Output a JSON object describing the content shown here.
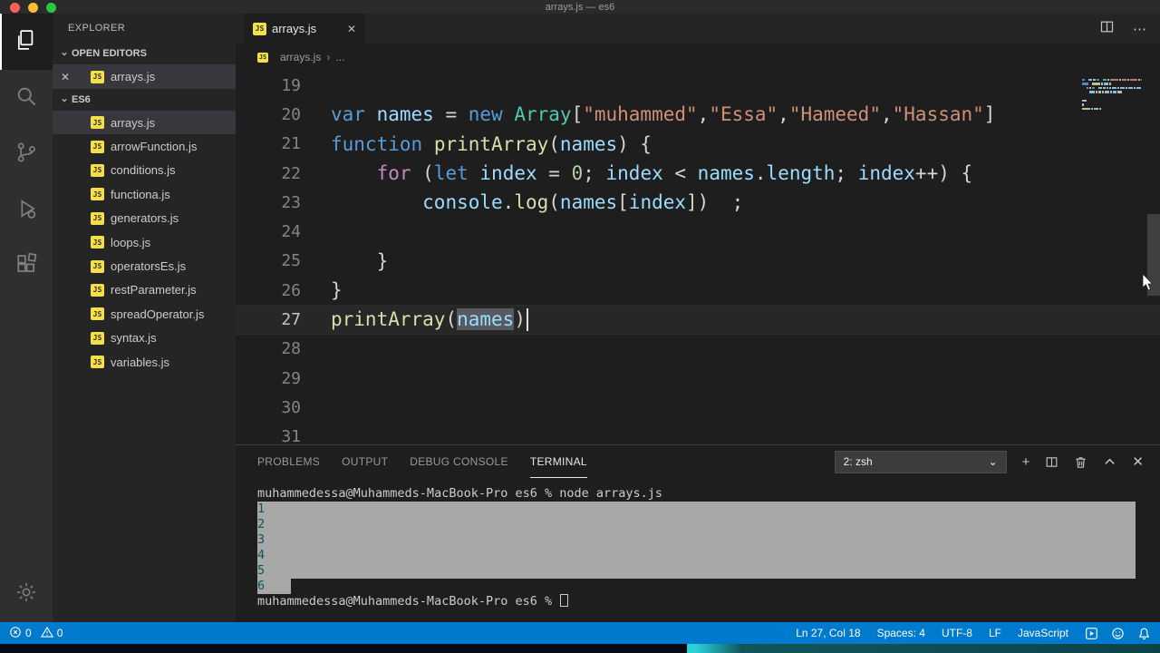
{
  "window": {
    "title": "arrays.js — es6"
  },
  "activity_bar": {
    "items": [
      {
        "name": "explorer",
        "active": true
      },
      {
        "name": "search",
        "active": false
      },
      {
        "name": "source-control",
        "active": false
      },
      {
        "name": "run-debug",
        "active": false
      },
      {
        "name": "extensions",
        "active": false
      }
    ],
    "bottom": [
      {
        "name": "settings"
      }
    ]
  },
  "sidebar": {
    "title": "EXPLORER",
    "open_editors": {
      "label": "OPEN EDITORS",
      "items": [
        {
          "name": "arrays.js",
          "active": true
        }
      ]
    },
    "folder": {
      "label": "ES6",
      "items": [
        {
          "name": "arrays.js",
          "selected": true
        },
        {
          "name": "arrowFunction.js"
        },
        {
          "name": "conditions.js"
        },
        {
          "name": "functiona.js"
        },
        {
          "name": "generators.js"
        },
        {
          "name": "loops.js"
        },
        {
          "name": "operatorsEs.js"
        },
        {
          "name": "restParameter.js"
        },
        {
          "name": "spreadOperator.js"
        },
        {
          "name": "syntax.js"
        },
        {
          "name": "variables.js"
        }
      ]
    }
  },
  "editor": {
    "tabs": [
      {
        "label": "arrays.js",
        "active": true
      }
    ],
    "breadcrumb": {
      "file": "arrays.js",
      "more": "..."
    },
    "lines": [
      {
        "num": 19,
        "tokens": []
      },
      {
        "num": 20,
        "tokens": [
          [
            "kw",
            "var"
          ],
          [
            "pn",
            " "
          ],
          [
            "var",
            "names"
          ],
          [
            "pn",
            " = "
          ],
          [
            "kw",
            "new"
          ],
          [
            "pn",
            " "
          ],
          [
            "cls",
            "Array"
          ],
          [
            "pn",
            "["
          ],
          [
            "str",
            "\"muhammed\""
          ],
          [
            "pn",
            ","
          ],
          [
            "str",
            "\"Essa\""
          ],
          [
            "pn",
            ","
          ],
          [
            "str",
            "\"Hameed\""
          ],
          [
            "pn",
            ","
          ],
          [
            "str",
            "\"Hassan\""
          ],
          [
            "pn",
            "]"
          ]
        ]
      },
      {
        "num": 21,
        "tokens": [
          [
            "kw",
            "function"
          ],
          [
            "pn",
            " "
          ],
          [
            "fn",
            "printArray"
          ],
          [
            "pn",
            "("
          ],
          [
            "var",
            "names"
          ],
          [
            "pn",
            ") {"
          ]
        ]
      },
      {
        "num": 22,
        "tokens": [
          [
            "pn",
            "    "
          ],
          [
            "ctrl",
            "for"
          ],
          [
            "pn",
            " ("
          ],
          [
            "kw",
            "let"
          ],
          [
            "pn",
            " "
          ],
          [
            "var",
            "index"
          ],
          [
            "pn",
            " = "
          ],
          [
            "num",
            "0"
          ],
          [
            "pn",
            "; "
          ],
          [
            "var",
            "index"
          ],
          [
            "pn",
            " < "
          ],
          [
            "var",
            "names"
          ],
          [
            "pn",
            "."
          ],
          [
            "var",
            "length"
          ],
          [
            "pn",
            "; "
          ],
          [
            "var",
            "index"
          ],
          [
            "pn",
            "++) {"
          ]
        ]
      },
      {
        "num": 23,
        "tokens": [
          [
            "pn",
            "        "
          ],
          [
            "var",
            "console"
          ],
          [
            "pn",
            "."
          ],
          [
            "fn",
            "log"
          ],
          [
            "pn",
            "("
          ],
          [
            "var",
            "names"
          ],
          [
            "pn",
            "["
          ],
          [
            "var",
            "index"
          ],
          [
            "pn",
            "])  ;"
          ]
        ]
      },
      {
        "num": 24,
        "tokens": []
      },
      {
        "num": 25,
        "tokens": [
          [
            "pn",
            "    }"
          ]
        ]
      },
      {
        "num": 26,
        "tokens": [
          [
            "pn",
            "}"
          ]
        ]
      },
      {
        "num": 27,
        "current": true,
        "tokens": [
          [
            "fn",
            "printArray"
          ],
          [
            "pn",
            "("
          ],
          [
            "hl",
            "names"
          ],
          [
            "pn",
            ")"
          ],
          [
            "cursor",
            ""
          ]
        ]
      },
      {
        "num": 28,
        "tokens": []
      },
      {
        "num": 29,
        "tokens": []
      },
      {
        "num": 30,
        "tokens": []
      },
      {
        "num": 31,
        "tokens": []
      }
    ]
  },
  "panel": {
    "tabs": [
      {
        "label": "PROBLEMS"
      },
      {
        "label": "OUTPUT"
      },
      {
        "label": "DEBUG CONSOLE"
      },
      {
        "label": "TERMINAL",
        "active": true
      }
    ],
    "shell_selector": "2: zsh",
    "terminal_lines": [
      {
        "text": "muhammedessa@Muhammeds-MacBook-Pro es6 % node arrays.js",
        "style": "plain"
      },
      {
        "text": "1",
        "style": "selected"
      },
      {
        "text": "2",
        "style": "selected"
      },
      {
        "text": "3",
        "style": "selected"
      },
      {
        "text": "4",
        "style": "selected"
      },
      {
        "text": "5",
        "style": "selected"
      },
      {
        "text": "6",
        "style": "selected-short"
      },
      {
        "text": "muhammedessa@Muhammeds-MacBook-Pro es6 % ",
        "style": "prompt-cursor"
      }
    ]
  },
  "status_bar": {
    "errors": "0",
    "warnings": "0",
    "items_right": [
      "Ln 27, Col 18",
      "Spaces: 4",
      "UTF-8",
      "LF",
      "JavaScript"
    ]
  },
  "icons": {
    "close": "✕",
    "add": "+",
    "more": "⋯",
    "chevron_down": "⌄",
    "breadcrumb_sep": "›",
    "js_badge": "JS"
  },
  "colors": {
    "status_bar": "#007ACC",
    "editor_bg": "#1e1e1e",
    "sidebar_bg": "#252526",
    "keyword": "#569CD6",
    "string": "#CE9178",
    "function": "#DCDCAA",
    "class": "#4EC9B0",
    "variable": "#9CDCFE"
  }
}
